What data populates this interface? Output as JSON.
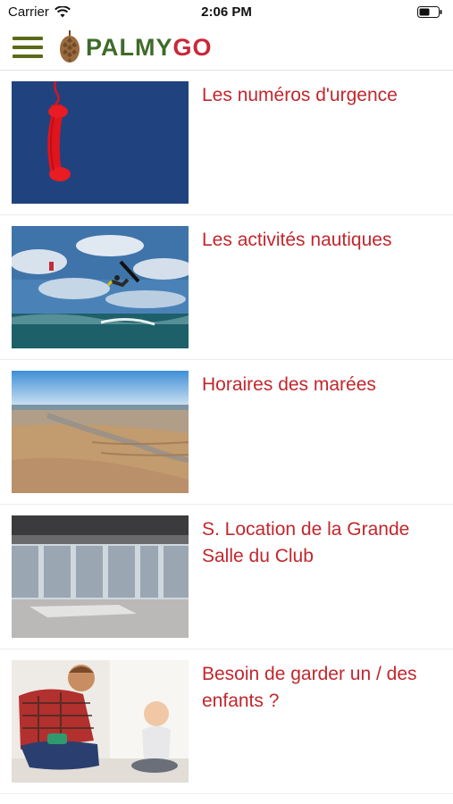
{
  "status_bar": {
    "carrier": "Carrier",
    "time": "2:06 PM"
  },
  "header": {
    "logo_part1": "PALMY",
    "logo_part2": "GO"
  },
  "items": [
    {
      "title": "Les numéros d'urgence"
    },
    {
      "title": "Les activités nautiques"
    },
    {
      "title": "Horaires des marées"
    },
    {
      "title": "S. Location de la Grande Salle du Club"
    },
    {
      "title": "Besoin de garder un / des enfants ?"
    }
  ],
  "colors": {
    "accent": "#c1272d",
    "brand_green": "#3f6b2a",
    "menu_green": "#5b6b1a"
  }
}
